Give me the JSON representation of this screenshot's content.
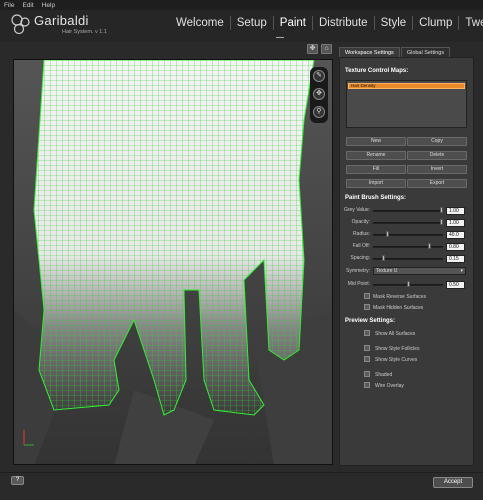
{
  "menubar": {
    "items": [
      "File",
      "Edit",
      "Help"
    ]
  },
  "header": {
    "brand": "Garibaldi",
    "subbrand": "Hair System. v 1.1",
    "tabs": [
      "Welcome",
      "Setup",
      "Paint",
      "Distribute",
      "Style",
      "Clump",
      "Tweak"
    ],
    "active_tab": "Paint"
  },
  "panel": {
    "tabs": [
      "Workspace Settings",
      "Global Settings"
    ],
    "texture_title": "Texture Control Maps:",
    "maps": [
      "Hair Density"
    ],
    "buttons": [
      "New",
      "Copy",
      "Rename",
      "Delete",
      "Fill",
      "Invert",
      "Import",
      "Export"
    ],
    "brush_title": "Paint Brush Settings:",
    "brush": [
      {
        "label": "Grey Value:",
        "value": "1.00",
        "level": 0.98
      },
      {
        "label": "Opacity:",
        "value": "1.00",
        "level": 0.98
      },
      {
        "label": "Radius:",
        "value": "40.0",
        "level": 0.2
      },
      {
        "label": "Fall Off:",
        "value": "0.80",
        "level": 0.8
      },
      {
        "label": "Spacing:",
        "value": "0.15",
        "level": 0.15
      }
    ],
    "symmetry_label": "Symmetry:",
    "symmetry_value": "Texture U",
    "midpoint_label": "Mid Point:",
    "midpoint_value": "0.50",
    "midpoint_level": 0.5,
    "mask_checks": [
      "Mask Reverse Surfaces",
      "Mask Hidden Surfaces"
    ],
    "preview_title": "Preview Settings:",
    "preview_checks": [
      "Show All Surfaces",
      "Show Style Follicles",
      "Show Style Curves",
      "Shaded",
      "Wire Overlay"
    ]
  },
  "footer": {
    "help": "?",
    "accept": "Accept"
  },
  "colors": {
    "wire": "#33dd33",
    "accent": "#e88a2c"
  }
}
